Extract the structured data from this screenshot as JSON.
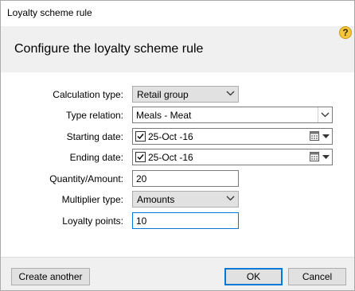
{
  "window": {
    "title": "Loyalty scheme rule"
  },
  "header": {
    "title": "Configure the loyalty scheme rule",
    "help_icon": "question-mark-icon",
    "help_glyph": "?"
  },
  "form": {
    "calculation_type": {
      "label": "Calculation type:",
      "value": "Retail group"
    },
    "type_relation": {
      "label": "Type relation:",
      "value": "Meals - Meat"
    },
    "starting_date": {
      "label": "Starting date:",
      "value": "25-Oct -16",
      "checked": true
    },
    "ending_date": {
      "label": "Ending date:",
      "value": "25-Oct -16",
      "checked": true
    },
    "quantity_amount": {
      "label": "Quantity/Amount:",
      "value": "20"
    },
    "multiplier_type": {
      "label": "Multiplier type:",
      "value": "Amounts"
    },
    "loyalty_points": {
      "label": "Loyalty points:",
      "value": "10"
    }
  },
  "footer": {
    "create_another": "Create another",
    "ok": "OK",
    "cancel": "Cancel"
  },
  "colors": {
    "accent": "#0078d7",
    "help_icon": "#f5c63b"
  }
}
